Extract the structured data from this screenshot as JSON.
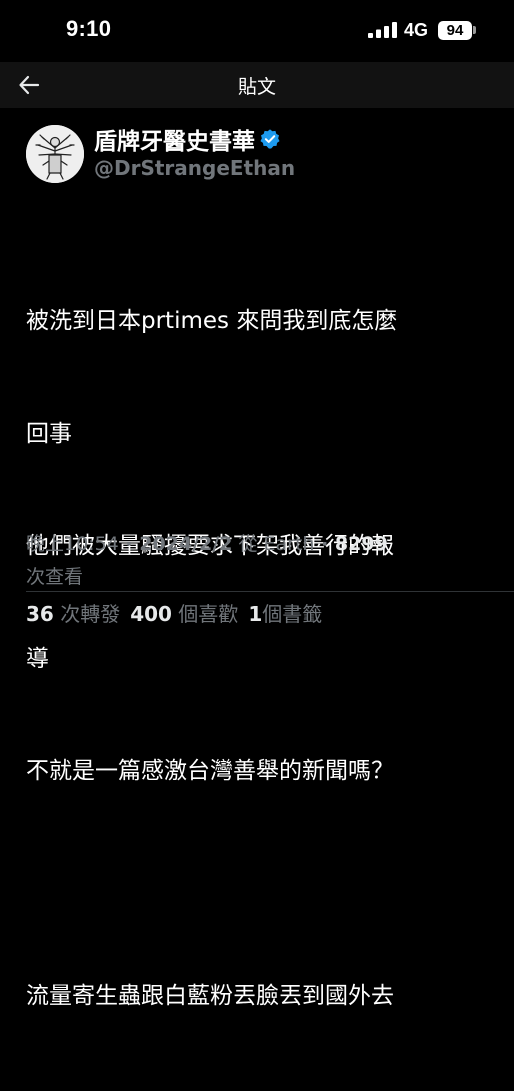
{
  "status_bar": {
    "time": "9:10",
    "network": "4G",
    "battery": "94"
  },
  "nav": {
    "title": "貼文",
    "back_icon": "arrow-left-icon"
  },
  "tweet": {
    "display_name": "盾牌牙醫史書華",
    "handle": "@DrStrangeEthan",
    "verified_color": "#1d9bf0",
    "body_lines": [
      "被洗到日本prtimes 來問我到底怎麼",
      "回事",
      "他們被大量騷擾要求下架我善行的報",
      "導",
      "不就是一篇感激台灣善舉的新聞嗎？",
      "",
      "流量寄生蟲跟白藍粉丟臉丟到國外去"
    ],
    "meta": {
      "time": "晚上10:54",
      "sep1": " · ",
      "date": "2024/2/2",
      "source": " 從 Earth",
      "sep2": " · ",
      "views_count": "8299",
      "views_label": "次查看"
    },
    "stats": {
      "retweets_count": "36",
      "retweets_label": " 次轉發",
      "likes_count": "400",
      "likes_label": " 個喜歡",
      "bookmarks_count": "1",
      "bookmarks_label": "個書籤"
    }
  }
}
